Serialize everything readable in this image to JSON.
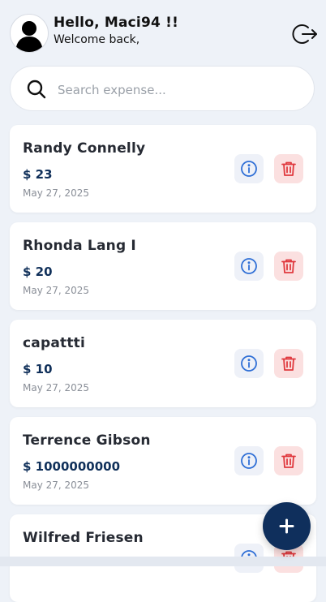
{
  "header": {
    "greeting": "Hello, Maci94 !!",
    "subtitle": "Welcome back,",
    "avatar_icon": "user-silhouette-icon",
    "logout_icon": "logout-icon"
  },
  "search": {
    "placeholder": "Search expense...",
    "value": "",
    "icon": "search-icon"
  },
  "expenses": [
    {
      "name": "Randy Connelly",
      "amount": "$ 23",
      "date": "May 27, 2025"
    },
    {
      "name": "Rhonda Lang I",
      "amount": "$ 20",
      "date": "May 27, 2025"
    },
    {
      "name": "capattti",
      "amount": "$ 10",
      "date": "May 27, 2025"
    },
    {
      "name": "Terrence Gibson",
      "amount": "$ 1000000000",
      "date": "May 27, 2025"
    },
    {
      "name": "Wilfred Friesen",
      "amount": "",
      "date": ""
    }
  ],
  "actions": {
    "info_icon": "info-icon",
    "delete_icon": "trash-icon",
    "add_icon": "plus-icon"
  },
  "colors": {
    "background": "#eef2f8",
    "amount": "#10305a",
    "fab": "#0f2f5c",
    "info": "#2f6fd6",
    "delete": "#e0393e",
    "delete_bg": "#fbe0e0",
    "info_bg": "#eef1f8"
  }
}
